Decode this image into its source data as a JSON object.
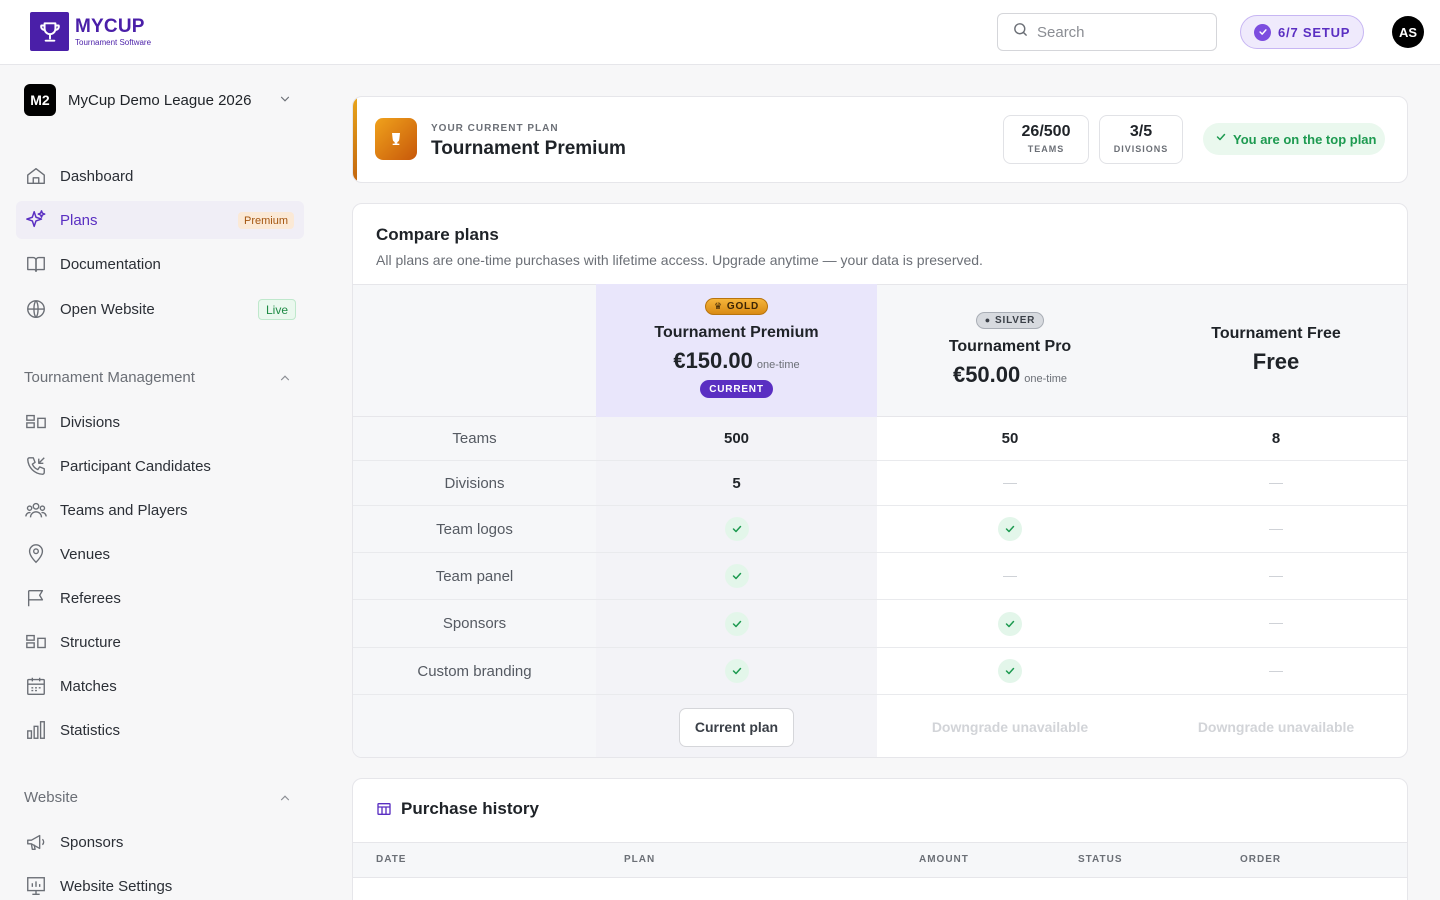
{
  "app": {
    "logo_title": "MYCUP",
    "logo_subtitle": "Tournament Software",
    "search_placeholder": "Search",
    "setup_label": "6/7 SETUP",
    "avatar_initials": "AS"
  },
  "league": {
    "badge": "M2",
    "name": "MyCup Demo League 2026"
  },
  "sidebar": {
    "main": [
      {
        "label": "Dashboard",
        "icon": "home-icon"
      },
      {
        "label": "Plans",
        "icon": "sparkles-icon",
        "badge": "Premium",
        "active": true
      },
      {
        "label": "Documentation",
        "icon": "book-icon"
      },
      {
        "label": "Open Website",
        "icon": "globe-icon",
        "badge": "Live"
      }
    ],
    "tournament_section": "Tournament Management",
    "tournament": [
      {
        "label": "Divisions",
        "icon": "divisions-icon"
      },
      {
        "label": "Participant Candidates",
        "icon": "phone-incoming-icon"
      },
      {
        "label": "Teams and Players",
        "icon": "users-icon"
      },
      {
        "label": "Venues",
        "icon": "location-pin-icon"
      },
      {
        "label": "Referees",
        "icon": "flag-icon"
      },
      {
        "label": "Structure",
        "icon": "structure-icon"
      },
      {
        "label": "Matches",
        "icon": "calendar-icon"
      },
      {
        "label": "Statistics",
        "icon": "bar-chart-icon"
      }
    ],
    "website_section": "Website",
    "website": [
      {
        "label": "Sponsors",
        "icon": "megaphone-icon"
      },
      {
        "label": "Website Settings",
        "icon": "monitor-settings-icon"
      }
    ]
  },
  "current_plan": {
    "kicker": "YOUR CURRENT PLAN",
    "name": "Tournament Premium",
    "teams_value": "26/500",
    "teams_label": "TEAMS",
    "divisions_value": "3/5",
    "divisions_label": "DIVISIONS",
    "top_plan_text": "You are on the top plan"
  },
  "compare": {
    "title": "Compare plans",
    "subtitle": "All plans are one-time purchases with lifetime access. Upgrade anytime — your data is preserved.",
    "plans": [
      {
        "tier": "GOLD",
        "name": "Tournament Premium",
        "price": "€150.00",
        "unit": "one-time",
        "current_badge": "CURRENT"
      },
      {
        "tier": "SILVER",
        "name": "Tournament Pro",
        "price": "€50.00",
        "unit": "one-time"
      },
      {
        "name": "Tournament Free",
        "price": "Free"
      }
    ],
    "features": [
      {
        "label": "Teams",
        "values": [
          "500",
          "50",
          "8"
        ]
      },
      {
        "label": "Divisions",
        "values": [
          "5",
          "—",
          "—"
        ]
      },
      {
        "label": "Team logos",
        "values": [
          "check",
          "check",
          "—"
        ]
      },
      {
        "label": "Team panel",
        "values": [
          "check",
          "—",
          "—"
        ]
      },
      {
        "label": "Sponsors",
        "values": [
          "check",
          "check",
          "—"
        ]
      },
      {
        "label": "Custom branding",
        "values": [
          "check",
          "check",
          "—"
        ]
      }
    ],
    "actions": {
      "current": "Current plan",
      "downgrade_pro": "Downgrade unavailable",
      "downgrade_free": "Downgrade unavailable"
    }
  },
  "history": {
    "title": "Purchase history",
    "columns": {
      "date": "DATE",
      "plan": "PLAN",
      "amount": "AMOUNT",
      "status": "STATUS",
      "order": "ORDER"
    }
  },
  "colors": {
    "brand": "#4a1fa8",
    "accent": "#5a2fc2",
    "success": "#1d9a50",
    "gold": "#d98b14"
  }
}
